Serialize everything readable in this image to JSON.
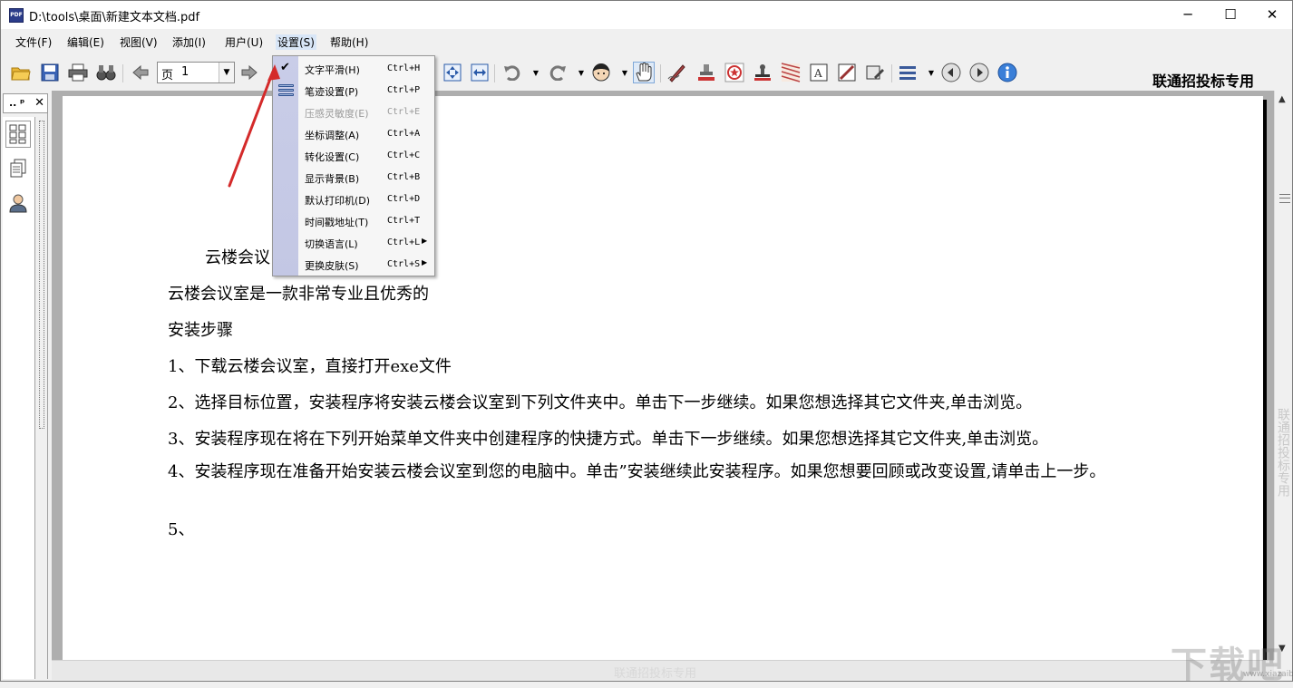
{
  "window": {
    "title": "D:\\tools\\桌面\\新建文本文档.pdf",
    "minimize": "─",
    "maximize": "☐",
    "close": "✕"
  },
  "menubar": {
    "items": [
      "文件(F)",
      "编辑(E)",
      "视图(V)",
      "添加(I)",
      "用户(U)",
      "设置(S)",
      "帮助(H)"
    ],
    "active_index": 5
  },
  "toolbar": {
    "page_label": "页",
    "page_value": "1",
    "brand_label": "联通招投标专用"
  },
  "left_panel": {
    "title": "..",
    "pin": "ᵖ",
    "close": "✕"
  },
  "document": {
    "lines": [
      "云楼会议",
      "云楼会议室是一款非常专业且优秀的",
      "安装步骤",
      "1、下载云楼会议室，直接打开exe文件",
      "2、选择目标位置，安装程序将安装云楼会议室到下列文件夹中。单击下一步继续。如果您想选择其它文件夹,单击浏览。",
      "3、安装程序现在将在下列开始菜单文件夹中创建程序的快捷方式。单击下一步继续。如果您想选择其它文件夹,单击浏览。",
      "4、安装程序现在准备开始安装云楼会议室到您的电脑中。单击”安装继续此安装程序。如果您想要回顾或改变设置,请单击上一步。",
      "5、"
    ]
  },
  "watermarks": {
    "vertical": "联通招投标专用",
    "bottom": "联通招投标专用",
    "corner_logo": "下载吧",
    "corner_url": "www.xiazaiba.com"
  },
  "settings_menu": {
    "items": [
      {
        "label": "文字平滑(H)",
        "shortcut": "Ctrl+H",
        "checked": true,
        "disabled": false,
        "submenu": false
      },
      {
        "label": "笔迹设置(P)",
        "shortcut": "Ctrl+P",
        "checked": false,
        "disabled": false,
        "submenu": false
      },
      {
        "label": "压感灵敏度(E)",
        "shortcut": "Ctrl+E",
        "checked": false,
        "disabled": true,
        "submenu": false
      },
      {
        "label": "坐标调整(A)",
        "shortcut": "Ctrl+A",
        "checked": false,
        "disabled": false,
        "submenu": false
      },
      {
        "label": "转化设置(C)",
        "shortcut": "Ctrl+C",
        "checked": false,
        "disabled": false,
        "submenu": false
      },
      {
        "label": "显示背景(B)",
        "shortcut": "Ctrl+B",
        "checked": false,
        "disabled": false,
        "submenu": false
      },
      {
        "label": "默认打印机(D)",
        "shortcut": "Ctrl+D",
        "checked": false,
        "disabled": false,
        "submenu": false
      },
      {
        "label": "时间戳地址(T)",
        "shortcut": "Ctrl+T",
        "checked": false,
        "disabled": false,
        "submenu": false
      },
      {
        "label": "切换语言(L)",
        "shortcut": "Ctrl+L",
        "checked": false,
        "disabled": false,
        "submenu": true
      },
      {
        "label": "更换皮肤(S)",
        "shortcut": "Ctrl+S",
        "checked": false,
        "disabled": false,
        "submenu": true
      }
    ],
    "check_glyph": "✔",
    "submenu_glyph": "▶"
  },
  "colors": {
    "menu_gutter": "#c6cae6",
    "annotation_arrow": "#d42a2a",
    "page_bg": "#ffffff",
    "doc_bg": "#aeaeae"
  }
}
